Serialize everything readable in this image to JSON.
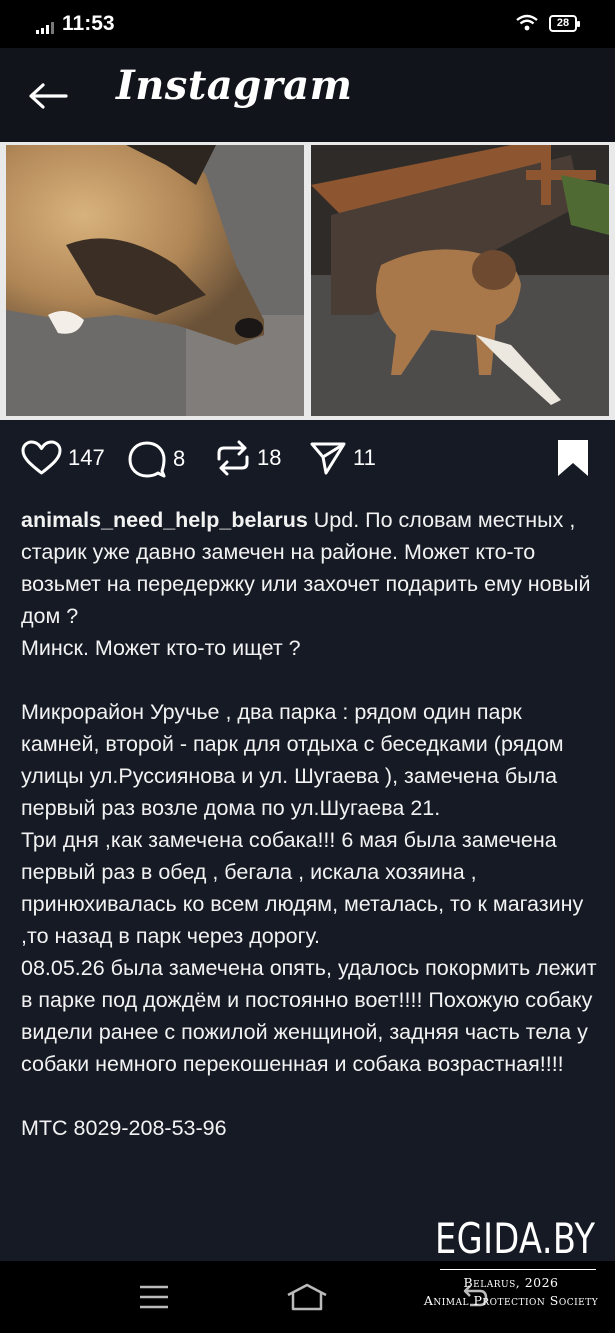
{
  "status_bar": {
    "time": "11:53",
    "battery": "28"
  },
  "header": {
    "brand": "Instagram"
  },
  "actions": {
    "likes": "147",
    "comments": "8",
    "reposts": "18",
    "shares": "11"
  },
  "caption": {
    "username": "animals_need_help_belarus",
    "line1_rest": " Upd. По словам местных , старик уже давно замечен на районе. Может кто-то возьмет на передержку или захочет подарить ему новый дом ?",
    "line2": "Минск. Может кто-то ищет ?",
    "para2": "Микрорайон Уручье , два парка : рядом один парк камней, второй - парк для отдыха с беседками (рядом улицы ул.Руссиянова и  ул. Шугаева ), замечена была первый раз возле дома по ул.Шугаева 21.",
    "para3": "Три дня ,как замечена собака!!! 6 мая была замечена первый раз в обед , бегала , искала хозяина , принюхивалась ко всем людям, металась, то к магазину ,то назад в парк через дорогу.",
    "para4": "08.05.26 была замечена опять, удалось покормить лежит в парке под дождём и постоянно воет!!!! Похожую собаку видели ранее с пожилой женщиной, задняя часть  тела у собаки немного  перекошенная и собака возрастная!!!!",
    "phone": "МТС 8029-208-53-96"
  },
  "watermark": {
    "logo": "EGIDA.BY",
    "line1": "Belarus, 2026",
    "line2": "Animal Protection Society"
  },
  "colors": {
    "page_bg": "#151a24",
    "header_bg": "#11141b",
    "text": "#f2f2f2"
  }
}
